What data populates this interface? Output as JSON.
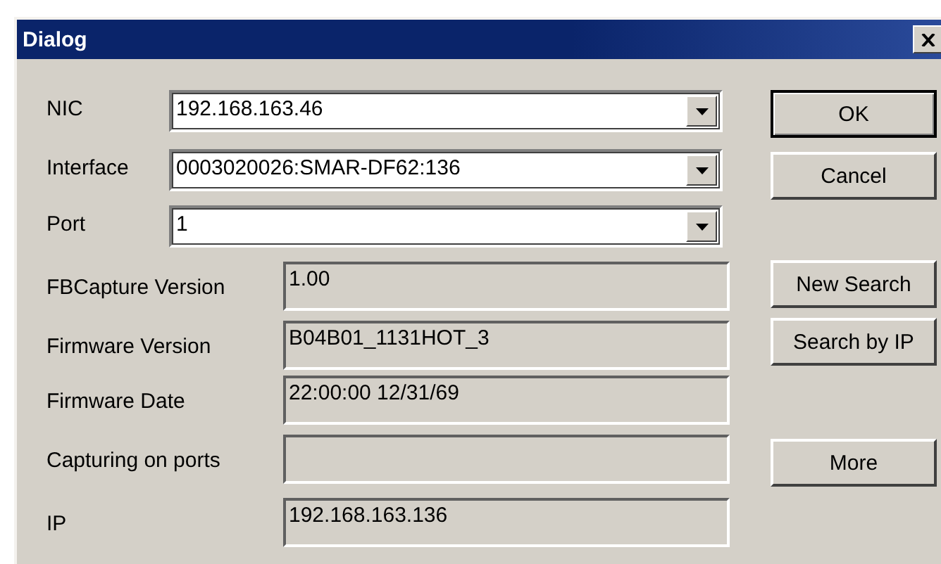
{
  "window": {
    "title": "Dialog"
  },
  "selectors": [
    {
      "label": "NIC",
      "value": "192.168.163.46"
    },
    {
      "label": "Interface",
      "value": "0003020026:SMAR-DF62:136"
    },
    {
      "label": "Port",
      "value": "1"
    }
  ],
  "info_fields": [
    {
      "label": "FBCapture Version",
      "value": "1.00"
    },
    {
      "label": "Firmware Version",
      "value": "B04B01_1131HOT_3"
    },
    {
      "label": "Firmware Date",
      "value": "22:00:00 12/31/69"
    },
    {
      "label": "Capturing on ports"
    },
    {
      "label": "IP",
      "value": "192.168.163.136"
    }
  ],
  "buttons": [
    {
      "label": "OK",
      "default": true
    },
    {
      "label": "Cancel",
      "default": false
    },
    {
      "label": "New Search",
      "default": false
    },
    {
      "label": "Search by IP",
      "default": false
    },
    {
      "label": "More",
      "default": false
    }
  ]
}
